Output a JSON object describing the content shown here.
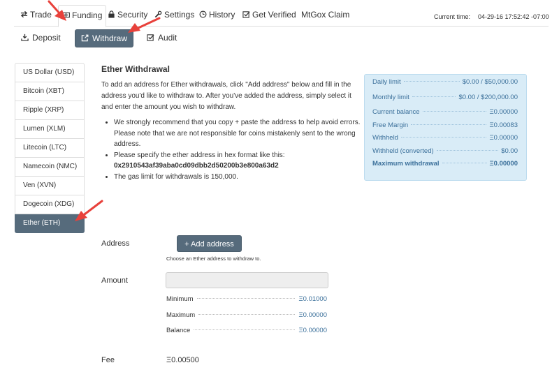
{
  "top_tabs": [
    {
      "label": "Trade",
      "icon": "exchange-icon"
    },
    {
      "label": "Funding",
      "icon": "money-icon",
      "active": true
    },
    {
      "label": "Security",
      "icon": "lock-icon"
    },
    {
      "label": "Settings",
      "icon": "wrench-icon"
    },
    {
      "label": "History",
      "icon": "clock-icon"
    },
    {
      "label": "Get Verified",
      "icon": "check-square-icon"
    },
    {
      "label": "MtGox Claim",
      "icon": ""
    }
  ],
  "current_time": {
    "label": "Current time:",
    "value": "04-29-16 17:52:42 -07:00"
  },
  "sub_tabs": [
    {
      "label": "Deposit",
      "icon": "download-icon"
    },
    {
      "label": "Withdraw",
      "icon": "external-link-icon",
      "active": true
    },
    {
      "label": "Audit",
      "icon": "check-square-icon"
    }
  ],
  "currencies": [
    "US Dollar (USD)",
    "Bitcoin (XBT)",
    "Ripple (XRP)",
    "Lumen (XLM)",
    "Litecoin (LTC)",
    "Namecoin (NMC)",
    "Ven (XVN)",
    "Dogecoin (XDG)",
    "Ether (ETH)"
  ],
  "active_currency_index": 8,
  "heading": "Ether Withdrawal",
  "intro": "To add an address for Ether withdrawals, click \"Add address\" below and fill in the address you'd like to withdraw to. After you've added the address, simply select it and enter the amount you wish to withdraw.",
  "bullets": {
    "b1": "We strongly recommend that you copy + paste the address to help avoid errors. Please note that we are not responsible for coins mistakenly sent to the wrong address.",
    "b2": "Please specify the ether address in hex format like this:",
    "hex": "0x2910543af39aba0cd09dbb2d50200b3e800a63d2",
    "b3": "The gas limit for withdrawals is 150,000."
  },
  "limits": [
    {
      "label": "Daily limit",
      "value": "$0.00 / $50,000.00"
    },
    {
      "label": "Monthly limit",
      "value": "$0.00 / $200,000.00"
    },
    {
      "label": "Current balance",
      "value": "Ξ0.00000"
    },
    {
      "label": "Free Margin",
      "value": "Ξ0.00083"
    },
    {
      "label": "Withheld",
      "value": "Ξ0.00000"
    },
    {
      "label": "Withheld (converted)",
      "value": "$0.00"
    },
    {
      "label": "Maximum withdrawal",
      "value": "Ξ0.00000"
    }
  ],
  "form": {
    "address_label": "Address",
    "add_address_button": "+ Add address",
    "address_help": "Choose an Ether address to withdraw to.",
    "amount_label": "Amount",
    "amount_value": "",
    "minimum_label": "Minimum",
    "minimum_value": "Ξ0.01000",
    "maximum_label": "Maximum",
    "maximum_value": "Ξ0.00000",
    "balance_label": "Balance",
    "balance_value": "Ξ0.00000",
    "fee_label": "Fee",
    "fee_value": "Ξ0.00500"
  },
  "colors": {
    "accent": "#566b7c",
    "panel_bg": "#d9ecf7",
    "panel_text": "#3a6f9a",
    "annotation": "#e8413b"
  }
}
